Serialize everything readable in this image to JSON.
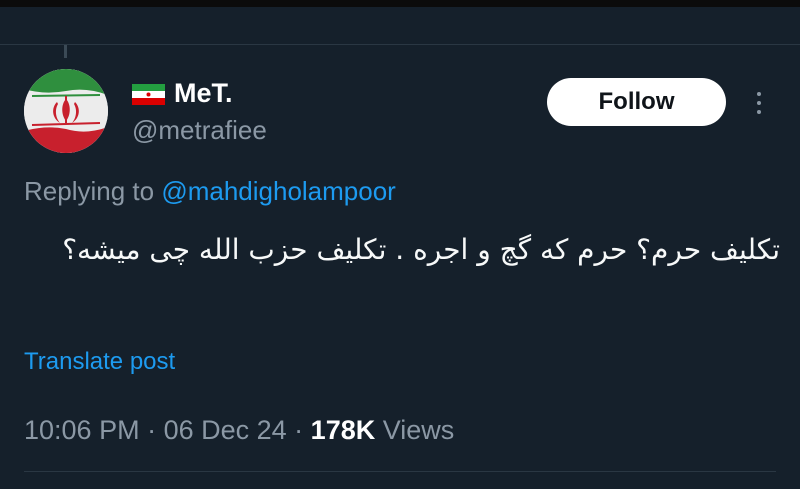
{
  "author": {
    "flag_icon": "iran-flag-icon",
    "display_name": "MeT.",
    "handle": "@metrafiee",
    "avatar_icon": "iran-emblem-avatar"
  },
  "actions": {
    "follow_label": "Follow",
    "more_icon": "more-vertical-icon"
  },
  "reply": {
    "prefix": "Replying to ",
    "target": "@mahdigholampoor"
  },
  "post": {
    "text": "تکلیف حرم؟ حرم که گچ و اجره . تکلیف حزب الله چی میشه؟",
    "translate_label": "Translate post"
  },
  "meta": {
    "time": "10:06 PM",
    "separator": " · ",
    "date": "06 Dec 24",
    "views_count": "178K",
    "views_label": " Views"
  },
  "colors": {
    "background": "#15202b",
    "accent": "#1d9bf0",
    "secondary_text": "#8b98a5",
    "follow_bg": "#ffffff"
  }
}
